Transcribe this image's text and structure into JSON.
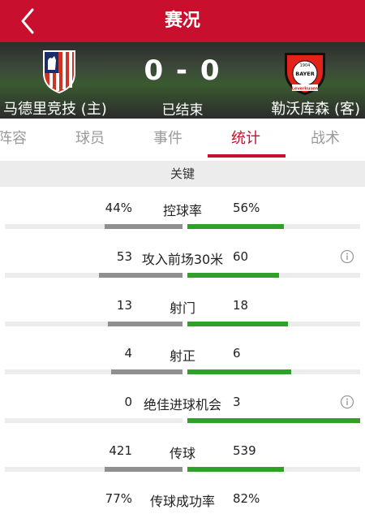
{
  "header": {
    "title": "赛况",
    "back_icon": "chevron-left-icon"
  },
  "match": {
    "score": "0 - 0",
    "status": "已结束",
    "home_team": "马德里竞技 (主)",
    "away_team": "勒沃库森 (客)",
    "home_crest": "atletico-madrid-crest",
    "away_crest": "bayer-leverkusen-crest",
    "away_crest_text_top": "1904",
    "away_crest_text_mid": "BAYER",
    "away_crest_text_bottom": "Leverkusen"
  },
  "tabs": [
    {
      "label": "阵容",
      "active": false
    },
    {
      "label": "球员",
      "active": false
    },
    {
      "label": "事件",
      "active": false
    },
    {
      "label": "统计",
      "active": true
    },
    {
      "label": "战术",
      "active": false
    }
  ],
  "section_title": "关键",
  "stats": [
    {
      "label": "控球率",
      "home": "44%",
      "away": "56%",
      "home_fraction": 0.44,
      "away_fraction": 0.56,
      "info": false
    },
    {
      "label": "攻入前场30米",
      "home": "53",
      "away": "60",
      "home_fraction": 0.469,
      "away_fraction": 0.531,
      "info": true
    },
    {
      "label": "射门",
      "home": "13",
      "away": "18",
      "home_fraction": 0.419,
      "away_fraction": 0.581,
      "info": false
    },
    {
      "label": "射正",
      "home": "4",
      "away": "6",
      "home_fraction": 0.4,
      "away_fraction": 0.6,
      "info": false
    },
    {
      "label": "绝佳进球机会",
      "home": "0",
      "away": "3",
      "home_fraction": 0.0,
      "away_fraction": 1.0,
      "info": true
    },
    {
      "label": "传球",
      "home": "421",
      "away": "539",
      "home_fraction": 0.439,
      "away_fraction": 0.561,
      "info": false
    },
    {
      "label": "传球成功率",
      "home": "77%",
      "away": "82%",
      "home_fraction": 0.77,
      "away_fraction": 0.82,
      "info": false
    }
  ],
  "colors": {
    "brand": "#c8102e",
    "home_bar": "#8f8f8f",
    "away_bar": "#2fa02a"
  }
}
